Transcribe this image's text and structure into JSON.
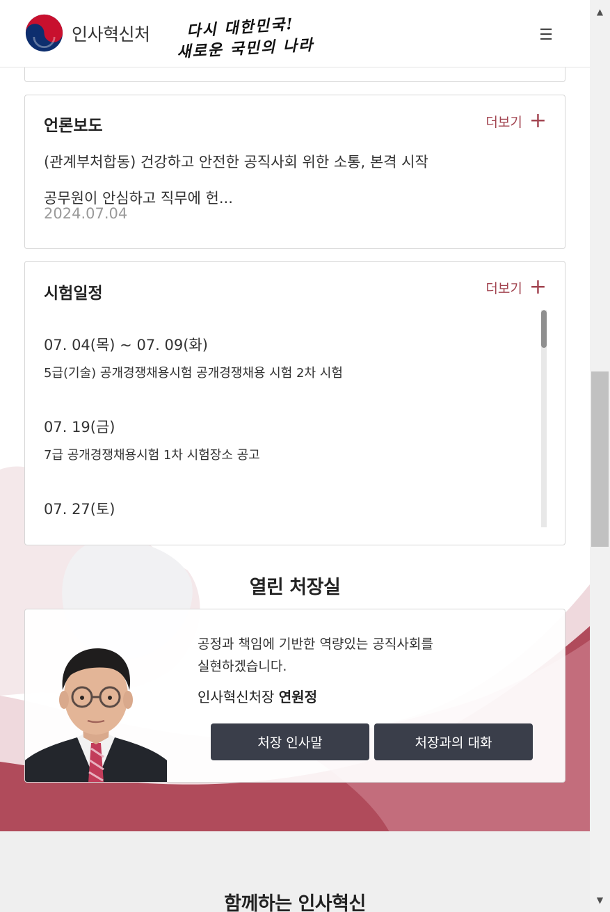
{
  "header": {
    "org_name": "인사혁신처",
    "slogan_line1": "다시 대한민국!",
    "slogan_line2": "새로운 국민의 나라",
    "menu_icon": "☰"
  },
  "press": {
    "title": "언론보도",
    "more_label": "더보기",
    "plus": "+",
    "line1": "(관계부처합동) 건강하고 안전한 공직사회 위한 소통, 본격 시작",
    "line2": "공무원이 안심하고 직무에 헌...",
    "date": "2024.07.04"
  },
  "exam": {
    "title": "시험일정",
    "more_label": "더보기",
    "plus": "+",
    "items": [
      {
        "date": "07. 04(목) ~ 07. 09(화)",
        "desc": "5급(기술) 공개경쟁채용시험 공개경쟁채용 시험 2차 시험"
      },
      {
        "date": "07. 19(금)",
        "desc": "7급 공개경쟁채용시험 1차 시험장소 공고"
      },
      {
        "date": "07. 27(토)",
        "desc": ""
      }
    ]
  },
  "office": {
    "section_title": "열린 처장실",
    "message_line1": "공정과 책임에 기반한 역량있는 공직사회를",
    "message_line2": "실현하겠습니다.",
    "position": "인사혁신처장",
    "name": "연원정",
    "btn_greeting": "처장 인사말",
    "btn_dialog": "처장과의 대화"
  },
  "together": {
    "title": "함께하는 인사혁신"
  },
  "colors": {
    "accent": "#a24450",
    "button": "#3a3e4a",
    "wave": "#b04b5b"
  },
  "scrollbar": {
    "up_icon": "▲",
    "down_icon": "▼"
  }
}
